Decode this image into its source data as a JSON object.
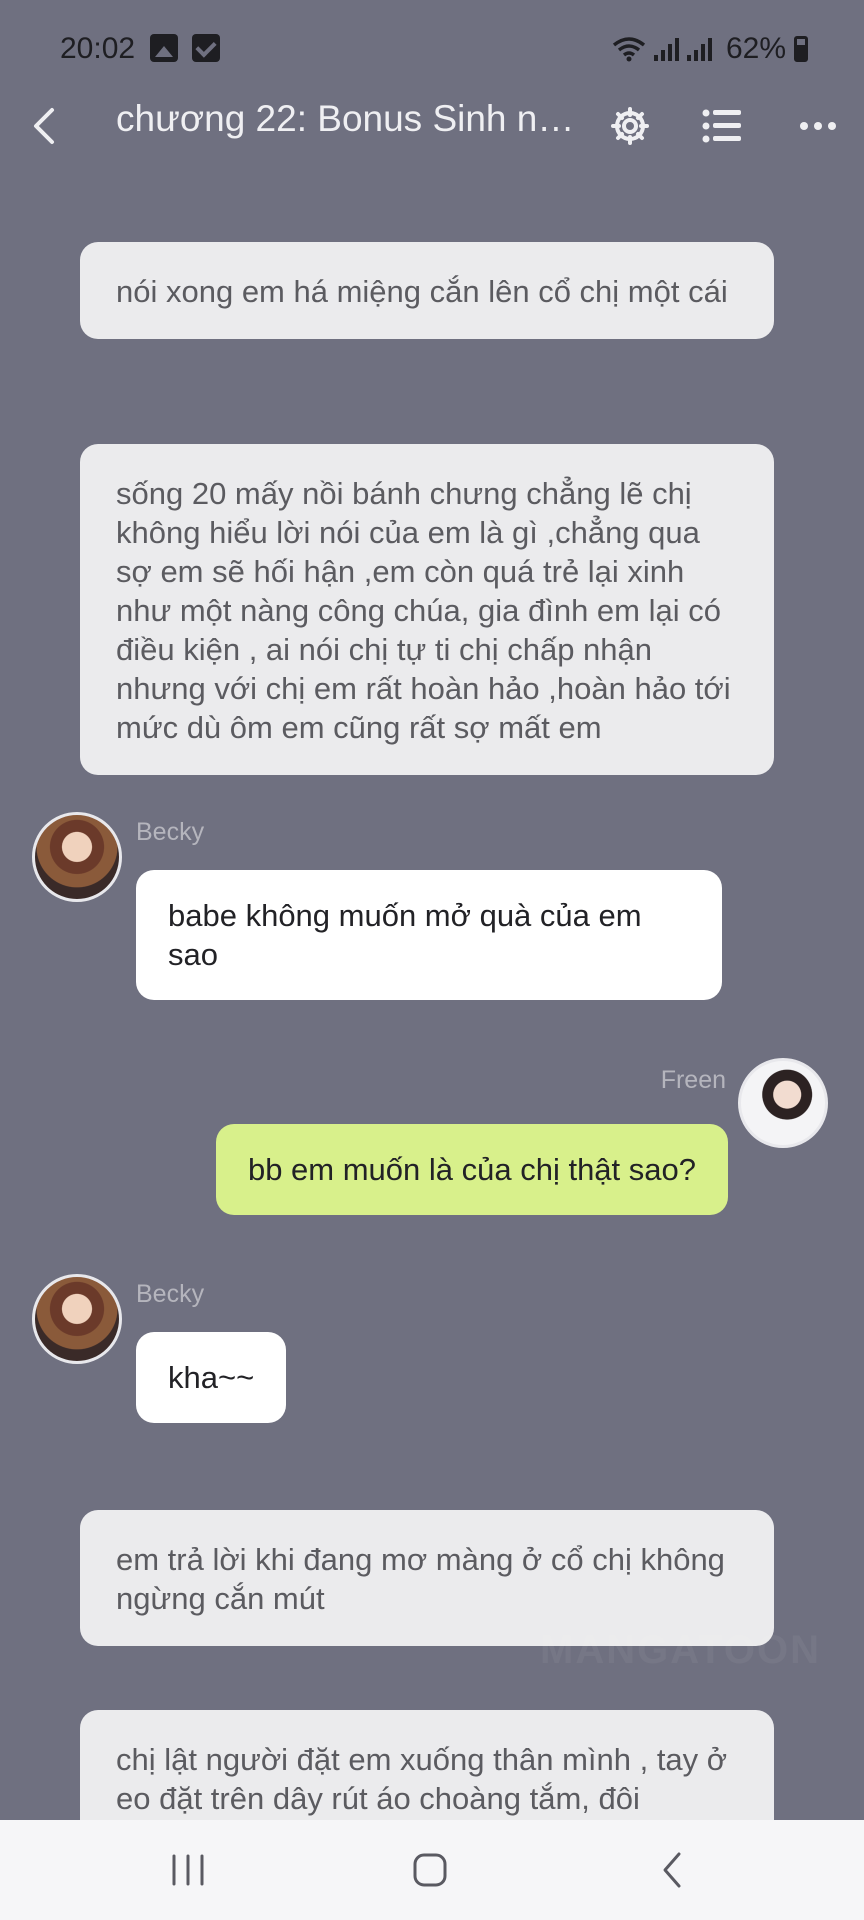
{
  "status_bar": {
    "time": "20:02",
    "battery": "62%"
  },
  "app_bar": {
    "title": "chương 22: Bonus Sinh nh..."
  },
  "messages": [
    {
      "type": "narration",
      "text": "nói xong em há miệng cắn lên cổ chị một cái"
    },
    {
      "type": "narration",
      "text": "sống 20 mấy nồi bánh chưng chẳng lẽ chị không hiểu lời nói của em là gì ,chẳng qua sợ em sẽ hối hận ,em còn quá trẻ lại xinh như một nàng công chúa, gia đình em lại có điều kiện , ai nói chị tự ti chị chấp nhận nhưng với chị em rất hoàn hảo ,hoàn hảo tới mức dù ôm em cũng rất sợ mất em"
    },
    {
      "type": "left",
      "sender": "Becky",
      "text": "babe không muốn mở quà của em sao"
    },
    {
      "type": "right",
      "sender": "Freen",
      "text": "bb em muốn là của chị thật sao?"
    },
    {
      "type": "left",
      "sender": "Becky",
      "text": "kha~~"
    },
    {
      "type": "narration",
      "text": "em trả lời khi đang mơ màng ở cổ chị không ngừng cắn mút"
    },
    {
      "type": "narration",
      "text": "chị lật người đặt em xuống thân mình , tay ở eo đặt trên dây rút áo choàng tắm, đôi"
    }
  ],
  "watermark": "MANGATOON",
  "colors": {
    "background": "#6f7080",
    "narration_bubble": "#ebebed",
    "left_bubble": "#ffffff",
    "right_bubble": "#d8f08b"
  },
  "icons": {
    "back": "back-chevron-icon",
    "settings": "gear-icon",
    "list": "list-icon",
    "more": "more-dots-icon"
  }
}
